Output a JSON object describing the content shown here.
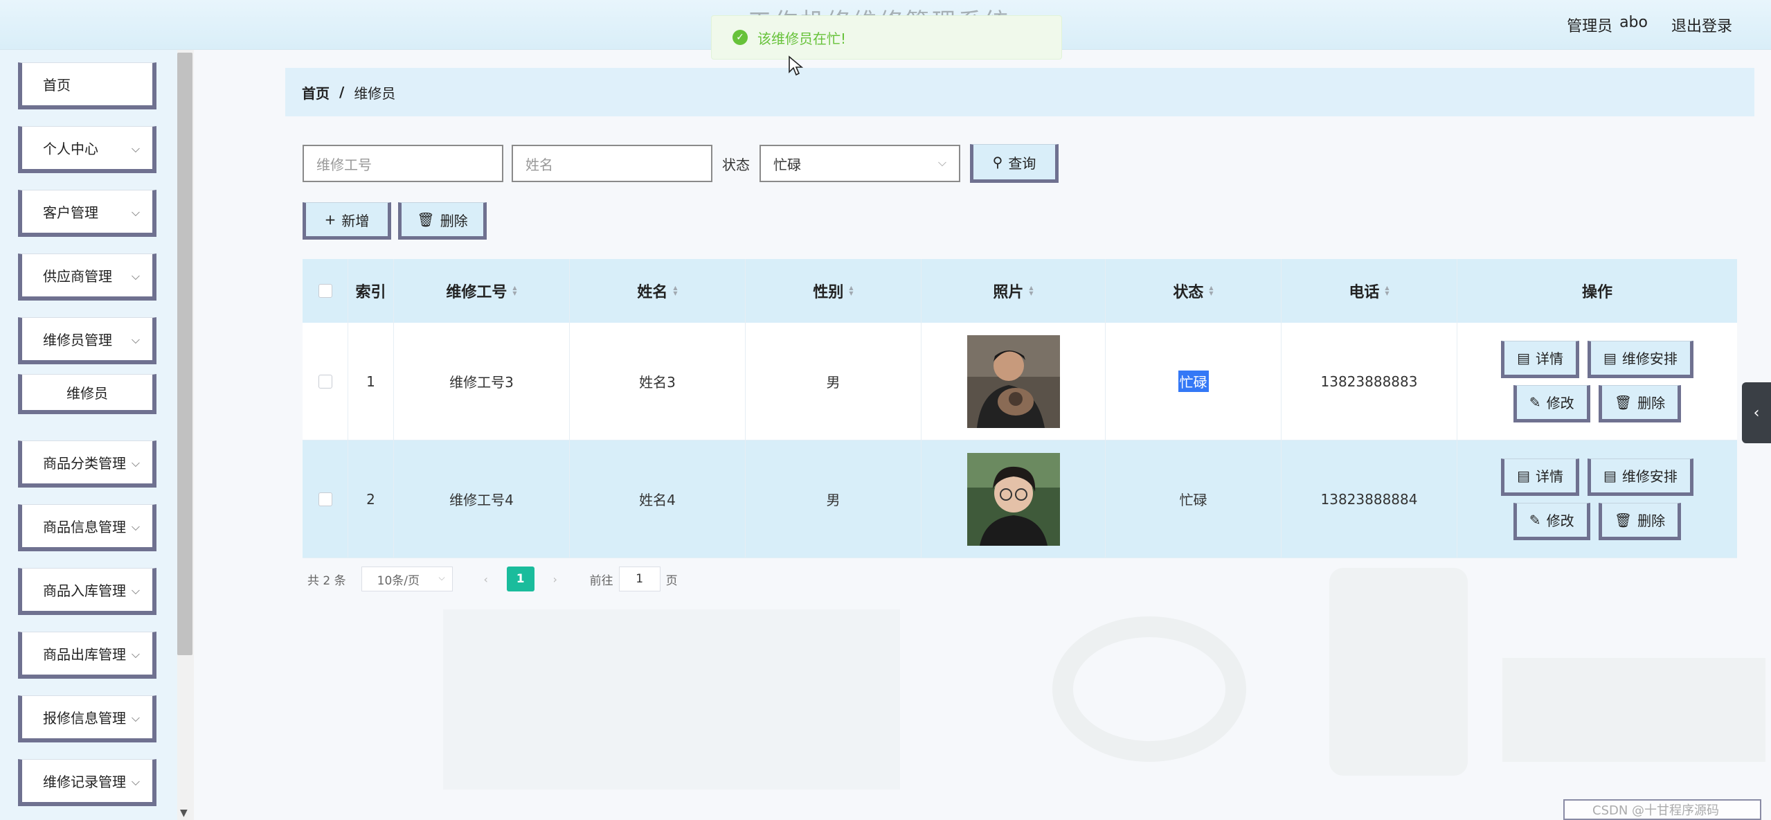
{
  "header": {
    "app_title": "工作机修维修管理系统",
    "role": "管理员",
    "username": "abo",
    "logout": "退出登录"
  },
  "toast": {
    "message": "该维修员在忙!"
  },
  "sidebar": {
    "items": [
      {
        "label": "首页",
        "has_children": false
      },
      {
        "label": "个人中心",
        "has_children": true
      },
      {
        "label": "客户管理",
        "has_children": true
      },
      {
        "label": "供应商管理",
        "has_children": true
      },
      {
        "label": "维修员管理",
        "has_children": true
      },
      {
        "label": "维修员",
        "sub": true
      },
      {
        "label": "商品分类管理",
        "has_children": true
      },
      {
        "label": "商品信息管理",
        "has_children": true
      },
      {
        "label": "商品入库管理",
        "has_children": true
      },
      {
        "label": "商品出库管理",
        "has_children": true
      },
      {
        "label": "报修信息管理",
        "has_children": true
      },
      {
        "label": "维修记录管理",
        "has_children": true
      }
    ]
  },
  "breadcrumb": {
    "home": "首页",
    "sep": "/",
    "current": "维修员"
  },
  "search": {
    "no_placeholder": "维修工号",
    "name_placeholder": "姓名",
    "status_label": "状态",
    "status_value": "忙碌",
    "query_label": "查询"
  },
  "actions": {
    "add_label": "新增",
    "delete_label": "删除"
  },
  "table": {
    "headers": {
      "index": "索引",
      "no": "维修工号",
      "name": "姓名",
      "sex": "性别",
      "photo": "照片",
      "status": "状态",
      "phone": "电话",
      "ops": "操作"
    },
    "rows": [
      {
        "index": "1",
        "no": "维修工号3",
        "name": "姓名3",
        "sex": "男",
        "status": "忙碌",
        "phone": "13823888883"
      },
      {
        "index": "2",
        "no": "维修工号4",
        "name": "姓名4",
        "sex": "男",
        "status": "忙碌",
        "phone": "13823888884"
      }
    ],
    "op_labels": {
      "detail": "详情",
      "arrange": "维修安排",
      "edit": "修改",
      "delete": "删除"
    }
  },
  "pagination": {
    "total_prefix": "共",
    "total": "2",
    "total_suffix": "条",
    "page_size": "10条/页",
    "current_page": "1",
    "goto_prefix": "前往",
    "goto_value": "1",
    "goto_suffix": "页"
  },
  "watermark": "CSDN @十甘程序源码"
}
